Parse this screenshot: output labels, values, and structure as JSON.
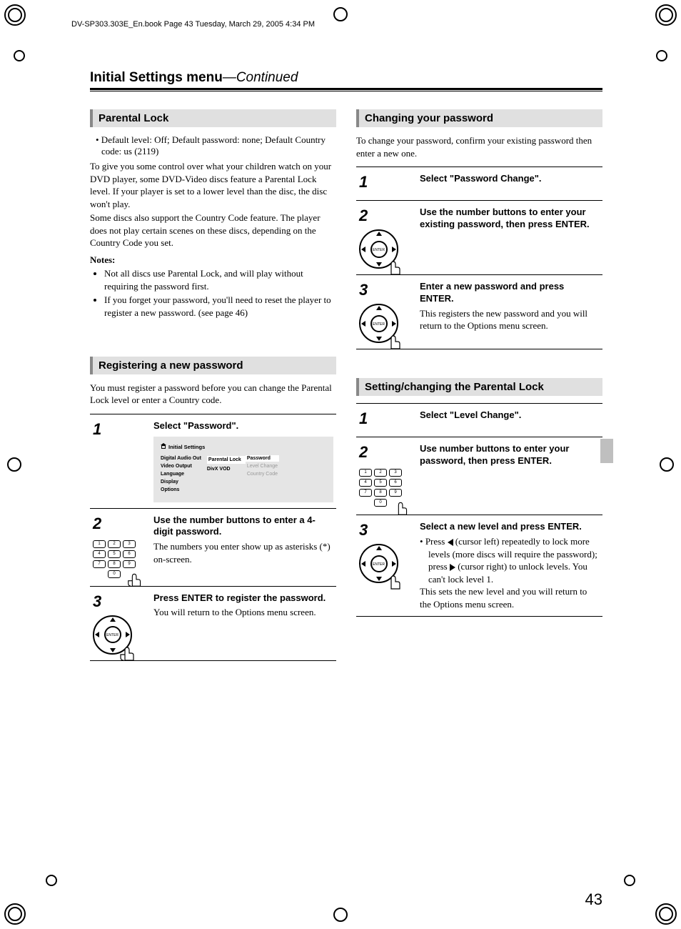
{
  "meta_header": "DV-SP303.303E_En.book  Page 43  Tuesday, March 29, 2005  4:34 PM",
  "page_title": "Initial Settings menu",
  "page_title_suffix": "—Continued",
  "page_number": "43",
  "left": {
    "sec1_heading": "Parental Lock",
    "sec1_bullet": "• Default level: Off; Default password: none; Default Country code: us (2119)",
    "sec1_p1": "To give you some control over what your children watch on your DVD player, some DVD-Video discs feature a Parental Lock level. If your player is set to a lower level than the disc, the disc won't play.",
    "sec1_p2": "Some discs also support the Country Code feature. The player does not play certain scenes on these discs, depending on the Country Code you set.",
    "notes_label": "Notes:",
    "note1": "Not all discs use Parental Lock, and will play without requiring the password first.",
    "note2": "If you forget your password, you'll need to reset the player to register a new password. (see page 46)",
    "sec2_heading": "Registering a new password",
    "sec2_intro": "You must register a password before you can change the Parental Lock level or enter a Country code.",
    "step1_bold": "Select \"Password\".",
    "step2_bold": "Use the number buttons to enter a 4-digit password.",
    "step2_body": "The numbers you enter show up as asterisks (*) on-screen.",
    "step3_bold": "Press ENTER to register the password.",
    "step3_body": "You will return to the Options menu screen.",
    "osd": {
      "title": "Initial Settings",
      "col1": [
        "Digital Audio Out",
        "Video Output",
        "Language",
        "Display",
        "Options"
      ],
      "col2": [
        "Parental Lock",
        "DivX VOD"
      ],
      "col3": [
        "Password",
        "Level Change",
        "Country Code"
      ]
    }
  },
  "right": {
    "sec1_heading": "Changing your password",
    "sec1_intro": "To change your password, confirm your existing password then enter a new one.",
    "step1_bold": "Select \"Password Change\".",
    "step2_bold": "Use the number buttons to enter your existing password, then press ENTER.",
    "step3_bold": "Enter a new password and press ENTER.",
    "step3_body": "This registers the new password and you will return to the Options menu screen.",
    "sec2_heading": "Setting/changing the Parental Lock",
    "b_step1_bold": "Select \"Level Change\".",
    "b_step2_bold": "Use number buttons to enter your password, then press ENTER.",
    "b_step3_bold": "Select a new level and press ENTER.",
    "b_step3_bullet_a": "Press ",
    "b_step3_bullet_b": " (cursor left) repeatedly to lock more levels (more discs will require the password); press ",
    "b_step3_bullet_c": " (cursor right) to unlock levels. You can't lock level 1.",
    "b_step3_tail": "This sets the new level and you will return to the Options menu screen."
  },
  "labels": {
    "n1": "1",
    "n2": "2",
    "n3": "3",
    "enter": "ENTER"
  },
  "keypad": [
    "1",
    "2",
    "3",
    "4",
    "5",
    "6",
    "7",
    "8",
    "9",
    "0"
  ]
}
